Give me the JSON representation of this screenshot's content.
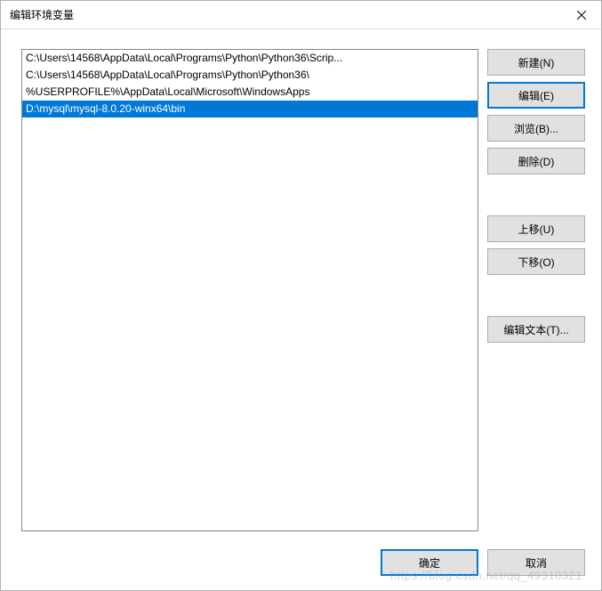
{
  "window": {
    "title": "编辑环境变量"
  },
  "list": {
    "items": [
      {
        "text": "C:\\Users\\14568\\AppData\\Local\\Programs\\Python\\Python36\\Scrip...",
        "selected": false
      },
      {
        "text": "C:\\Users\\14568\\AppData\\Local\\Programs\\Python\\Python36\\",
        "selected": false
      },
      {
        "text": "%USERPROFILE%\\AppData\\Local\\Microsoft\\WindowsApps",
        "selected": false
      },
      {
        "text": "D:\\mysql\\mysql-8.0.20-winx64\\bin",
        "selected": true
      }
    ]
  },
  "buttons": {
    "new": "新建(N)",
    "edit": "编辑(E)",
    "browse": "浏览(B)...",
    "delete": "删除(D)",
    "move_up": "上移(U)",
    "move_down": "下移(O)",
    "edit_text": "编辑文本(T)...",
    "ok": "确定",
    "cancel": "取消"
  },
  "watermark": "https://blog.csdn.net/qq_49310321"
}
